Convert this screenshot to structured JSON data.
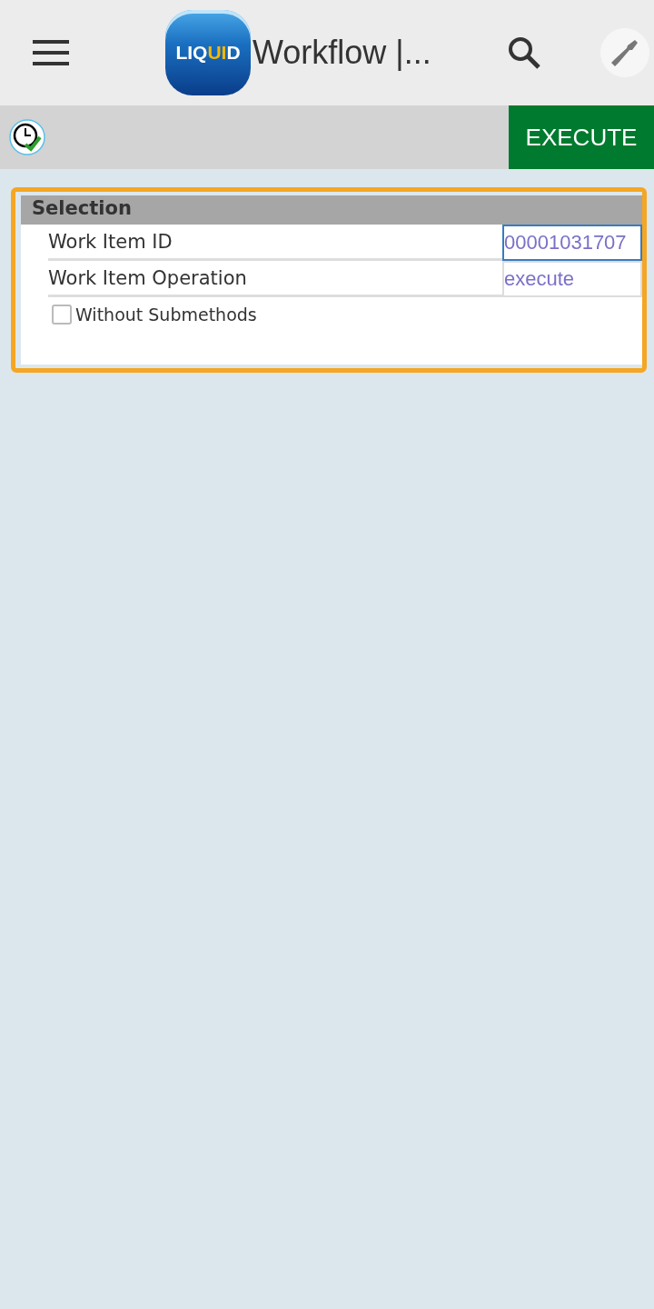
{
  "header": {
    "logo_parts": [
      {
        "text": "LIQ",
        "color": "#ffffff"
      },
      {
        "text": "UI",
        "color": "#f5b800"
      },
      {
        "text": "D",
        "color": "#ffffff"
      }
    ],
    "title": "Workflow |..."
  },
  "toolbar": {
    "execute_button": "EXECUTE"
  },
  "panel": {
    "title": "Selection",
    "fields": [
      {
        "label": "Work Item ID",
        "value": "00001031707",
        "focused": true
      },
      {
        "label": "Work Item Operation",
        "value": "execute",
        "focused": false
      }
    ],
    "checkbox": {
      "label": "Without Submethods",
      "checked": false
    }
  }
}
